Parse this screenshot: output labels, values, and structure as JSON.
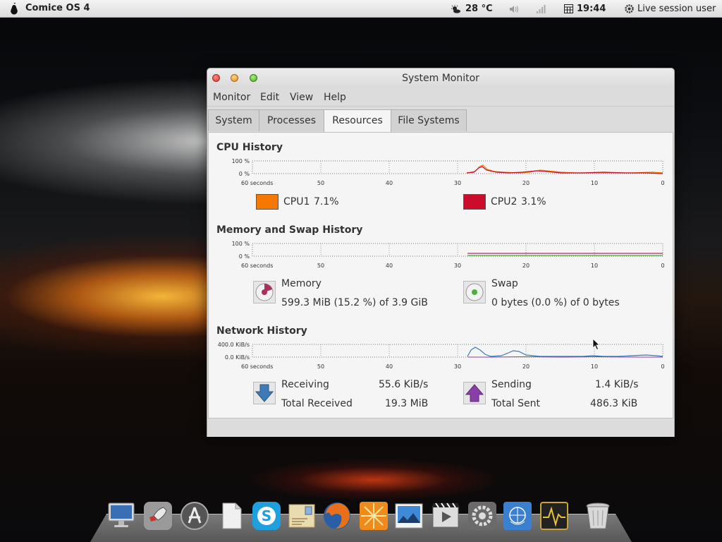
{
  "top_panel": {
    "os_name": "Comice OS 4",
    "weather": "28 °C",
    "time": "19:44",
    "session": "Live session user"
  },
  "window": {
    "title": "System Monitor",
    "menu": [
      "Monitor",
      "Edit",
      "View",
      "Help"
    ],
    "tabs": [
      "System",
      "Processes",
      "Resources",
      "File Systems"
    ],
    "active_tab": "Resources"
  },
  "cpu": {
    "title": "CPU History",
    "y_labels": [
      "100 %",
      "0 %"
    ],
    "x_labels": [
      "60 seconds",
      "50",
      "40",
      "30",
      "20",
      "10",
      "0"
    ],
    "cpu1": {
      "label": "CPU1",
      "value": "7.1%",
      "color": "#f57900"
    },
    "cpu2": {
      "label": "CPU2",
      "value": "3.1%",
      "color": "#cc0c2a"
    }
  },
  "memory": {
    "title": "Memory and Swap History",
    "y_labels": [
      "100 %",
      "0 %"
    ],
    "x_labels": [
      "60 seconds",
      "50",
      "40",
      "30",
      "20",
      "10",
      "0"
    ],
    "memory_label": "Memory",
    "memory_value": "599.3 MiB (15.2 %) of 3.9 GiB",
    "swap_label": "Swap",
    "swap_value": "0 bytes (0.0 %) of 0 bytes",
    "memory_color": "#ad2d5d",
    "swap_color": "#4caf3c"
  },
  "network": {
    "title": "Network History",
    "y_labels": [
      "400.0 KiB/s",
      "0.0 KiB/s"
    ],
    "x_labels": [
      "60 seconds",
      "50",
      "40",
      "30",
      "20",
      "10",
      "0"
    ],
    "receiving_label": "Receiving",
    "receiving_value": "55.6 KiB/s",
    "total_received_label": "Total Received",
    "total_received_value": "19.3 MiB",
    "sending_label": "Sending",
    "sending_value": "1.4 KiB/s",
    "total_sent_label": "Total Sent",
    "total_sent_value": "486.3 KiB",
    "receiving_color": "#3d7ab8",
    "sending_color": "#8a3fa8"
  },
  "dock": {
    "icons": [
      "computer-icon",
      "rocket-launcher-icon",
      "app-store-icon",
      "files-icon",
      "skype-icon",
      "mail-icon",
      "firefox-icon",
      "sunburst-icon",
      "photos-icon",
      "video-player-icon",
      "system-settings-icon",
      "un-globe-icon",
      "system-monitor-icon",
      "trash-icon"
    ]
  }
}
